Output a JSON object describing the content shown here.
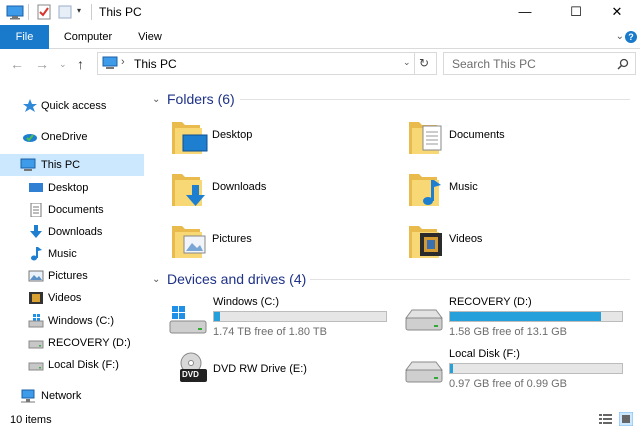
{
  "window": {
    "title": "This PC",
    "minimize": "—",
    "maximize": "☐",
    "close": "✕"
  },
  "ribbon": {
    "tabs": [
      "File",
      "Computer",
      "View"
    ]
  },
  "address": {
    "path": "This PC",
    "search_placeholder": "Search This PC"
  },
  "sidebar": {
    "items": [
      {
        "label": "Quick access",
        "icon": "star-icon"
      },
      {
        "label": "OneDrive",
        "icon": "onedrive-cloud-icon"
      },
      {
        "label": "This PC",
        "icon": "computer-icon",
        "selected": true
      },
      {
        "label": "Desktop",
        "icon": "desktop-icon"
      },
      {
        "label": "Documents",
        "icon": "documents-icon"
      },
      {
        "label": "Downloads",
        "icon": "downloads-icon"
      },
      {
        "label": "Music",
        "icon": "music-icon"
      },
      {
        "label": "Pictures",
        "icon": "pictures-icon"
      },
      {
        "label": "Videos",
        "icon": "videos-icon"
      },
      {
        "label": "Windows (C:)",
        "icon": "windows-drive-icon"
      },
      {
        "label": "RECOVERY (D:)",
        "icon": "drive-icon"
      },
      {
        "label": "Local Disk (F:)",
        "icon": "drive-icon"
      },
      {
        "label": "Network",
        "icon": "network-icon"
      }
    ]
  },
  "content": {
    "folders_heading": "Folders (6)",
    "folders": [
      {
        "label": "Desktop",
        "icon": "desktop-folder-icon"
      },
      {
        "label": "Documents",
        "icon": "documents-folder-icon"
      },
      {
        "label": "Downloads",
        "icon": "downloads-folder-icon"
      },
      {
        "label": "Music",
        "icon": "music-folder-icon"
      },
      {
        "label": "Pictures",
        "icon": "pictures-folder-icon"
      },
      {
        "label": "Videos",
        "icon": "videos-folder-icon"
      }
    ],
    "drives_heading": "Devices and drives (4)",
    "drives": [
      {
        "name": "Windows (C:)",
        "free": "1.74 TB free of 1.80 TB",
        "used_fraction": 0.033,
        "icon": "windows-drive-icon"
      },
      {
        "name": "RECOVERY (D:)",
        "free": "1.58 GB free of 13.1 GB",
        "used_fraction": 0.88,
        "icon": "drive-icon"
      },
      {
        "name": "DVD RW Drive (E:)",
        "free": "",
        "icon": "dvd-drive-icon"
      },
      {
        "name": "Local Disk (F:)",
        "free": "0.97 GB free of 0.99 GB",
        "used_fraction": 0.02,
        "icon": "drive-icon"
      }
    ],
    "dvd_label": "DVD"
  },
  "status": {
    "items_count": "10 items"
  },
  "colors": {
    "accent": "#1979ca",
    "selection": "#cce8ff",
    "heading": "#1e3287",
    "bar_fill": "#26a0da",
    "folder": "#f8d775"
  }
}
